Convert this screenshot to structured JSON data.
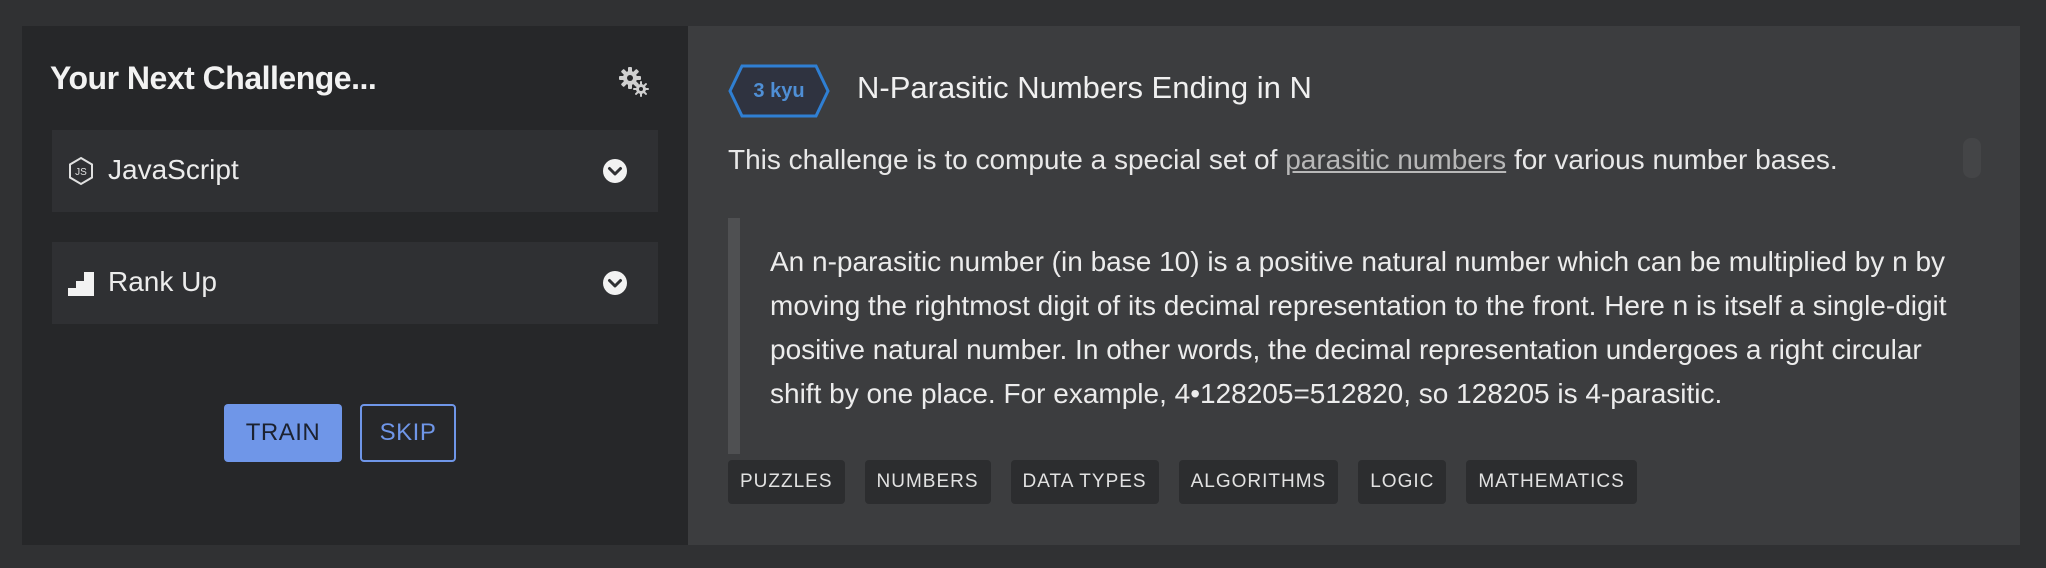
{
  "left_panel": {
    "title": "Your Next Challenge...",
    "settings_icon": "gear-icon",
    "language_select": {
      "value": "JavaScript",
      "icon": "javascript-icon"
    },
    "mode_select": {
      "value": "Rank Up",
      "icon": "rank-up-icon"
    },
    "train_label": "TRAIN",
    "skip_label": "SKIP"
  },
  "kata": {
    "rank": "3 kyu",
    "title": "N-Parasitic Numbers Ending in N",
    "intro_before": "This challenge is to compute a special set of ",
    "intro_link": "parasitic numbers",
    "intro_after": " for various number bases.",
    "quote": "An n-parasitic number (in base 10) is a positive natural number which can be multiplied by n by moving the rightmost digit of its decimal representation to the front. Here n is itself a single-digit positive natural number. In other words, the decimal representation undergoes a right circular shift by one place. For example, 4•128205=512820, so 128205 is 4-parasitic.",
    "tags": [
      "PUZZLES",
      "NUMBERS",
      "DATA TYPES",
      "ALGORITHMS",
      "LOGIC",
      "MATHEMATICS"
    ]
  },
  "colors": {
    "accent": "#6f96e8",
    "rank_badge": "#4f8fd6",
    "panel_dark": "#262729",
    "panel_content": "#3c3d3f"
  }
}
